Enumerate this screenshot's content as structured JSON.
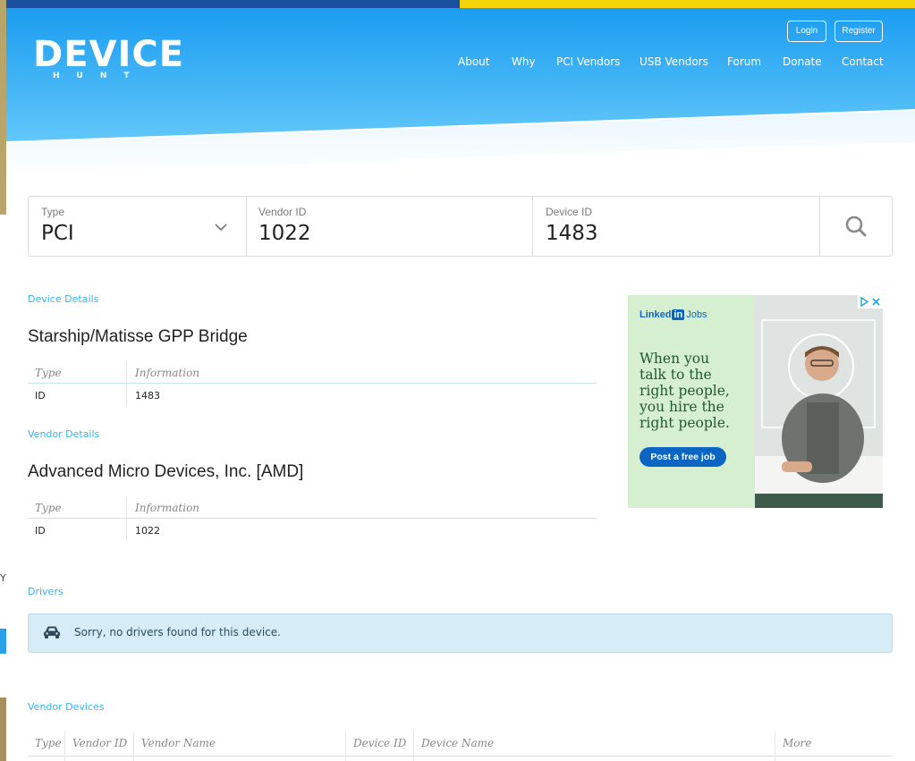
{
  "brand": {
    "name": "DEVICE",
    "sub": "HUNT"
  },
  "auth": {
    "login": "Login",
    "register": "Register"
  },
  "nav": [
    "About",
    "Why",
    "PCI Vendors",
    "USB Vendors",
    "Forum",
    "Donate",
    "Contact"
  ],
  "search": {
    "type_label": "Type",
    "type_value": "PCI",
    "vendor_label": "Vendor ID",
    "vendor_value": "1022",
    "device_label": "Device ID",
    "device_value": "1483"
  },
  "device_details": {
    "section": "Device Details",
    "title": "Starship/Matisse GPP Bridge",
    "col_type": "Type",
    "col_info": "Information",
    "row_key": "ID",
    "row_val": "1483"
  },
  "vendor_details": {
    "section": "Vendor Details",
    "title": "Advanced Micro Devices, Inc. [AMD]",
    "col_type": "Type",
    "col_info": "Information",
    "row_key": "ID",
    "row_val": "1022"
  },
  "drivers": {
    "section": "Drivers",
    "message": "Sorry, no drivers found for this device."
  },
  "vendor_devices": {
    "section": "Vendor Devices",
    "columns": [
      "Type",
      "Vendor ID",
      "Vendor Name",
      "Device ID",
      "Device Name",
      "More"
    ]
  },
  "ad": {
    "brand_a": "Linked",
    "brand_in": "in",
    "brand_b": "Jobs",
    "headline_lines": [
      "When you",
      "talk to the",
      "right people,",
      "you hire the",
      "right people."
    ],
    "cta": "Post a free job"
  },
  "colors": {
    "accent": "#39b3f0",
    "hero_top": "#1e9ef0",
    "hero_bottom": "#5ec6fa"
  },
  "left_edge_char": "Y"
}
